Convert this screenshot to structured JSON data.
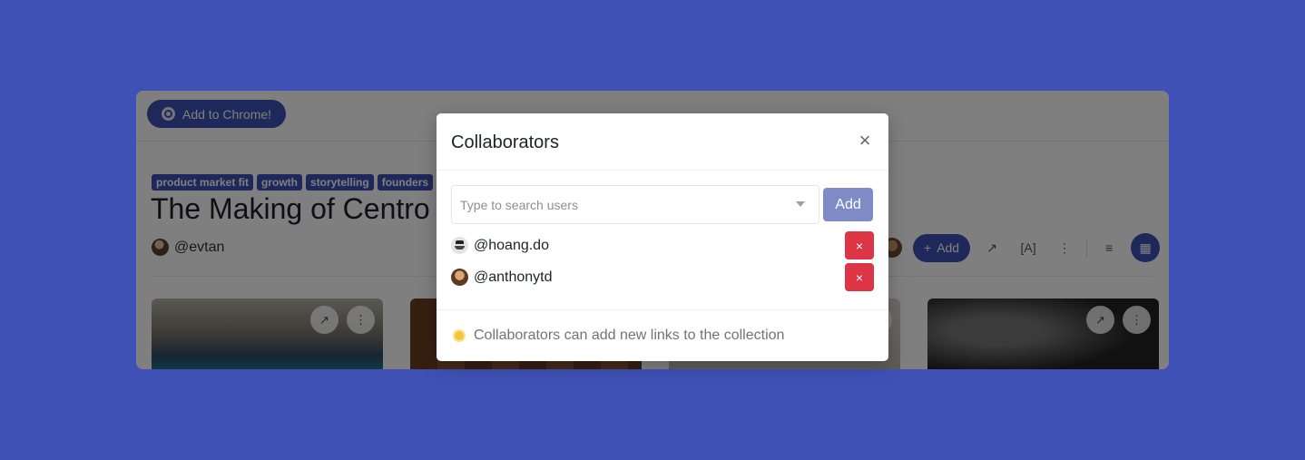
{
  "app": {
    "chrome_button_label": "Add to Chrome!",
    "tags": [
      "product market fit",
      "growth",
      "storytelling",
      "founders"
    ],
    "title": "The Making of Centro",
    "author": "@evtan",
    "toolbar": {
      "add_label": "Add"
    }
  },
  "modal": {
    "title": "Collaborators",
    "close_icon": "×",
    "search": {
      "placeholder": "Type to search users"
    },
    "add_button_label": "Add",
    "collaborators": [
      {
        "handle": "@hoang.do"
      },
      {
        "handle": "@anthonytd"
      }
    ],
    "remove_icon": "×",
    "footer_note": "Collaborators can add new links to the collection"
  },
  "colors": {
    "background": "#3f51b5",
    "primary": "#3f51b5",
    "primary_disabled": "#7e8bc6",
    "danger": "#dc3545"
  }
}
